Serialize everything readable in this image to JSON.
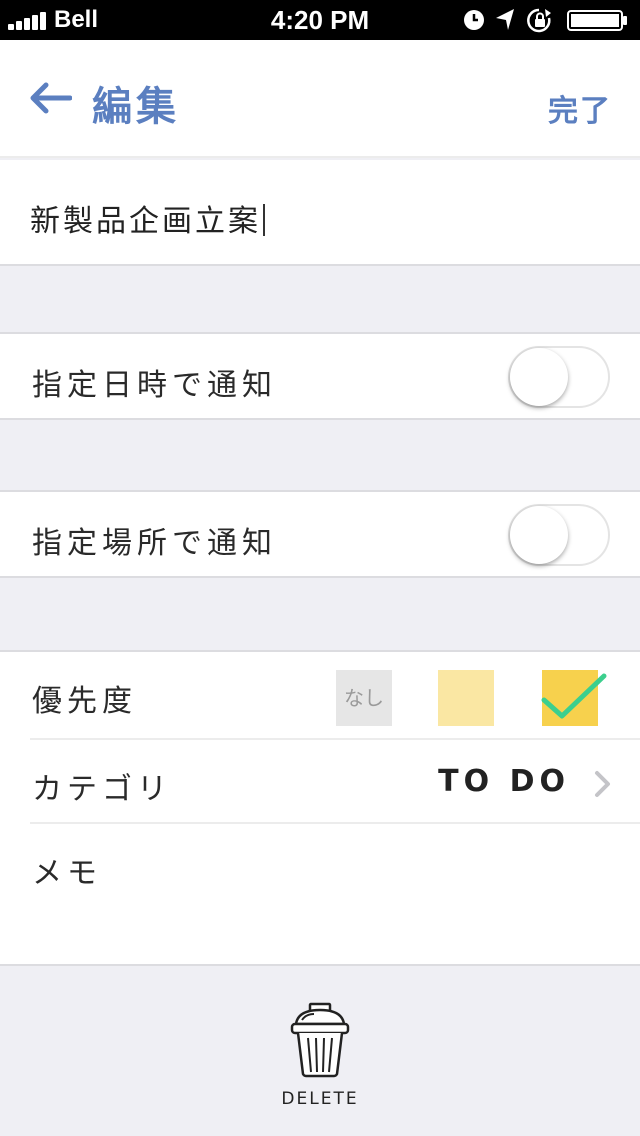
{
  "status_bar": {
    "carrier": "Bell",
    "time": "4:20 PM"
  },
  "nav": {
    "title": "編集",
    "done_label": "完了"
  },
  "task": {
    "title_value": "新製品企画立案"
  },
  "settings": {
    "notify_time_label": "指定日時で通知",
    "notify_time_on": false,
    "notify_place_label": "指定場所で通知",
    "notify_place_on": false
  },
  "priority": {
    "label": "優先度",
    "options": [
      {
        "label": "なし",
        "color": "#e6e6e6",
        "selected": false
      },
      {
        "label": "",
        "color": "#fae7a3",
        "selected": false
      },
      {
        "label": "",
        "color": "#f7d14d",
        "selected": true
      }
    ]
  },
  "category": {
    "label": "カテゴリ",
    "value": "TO DO"
  },
  "memo": {
    "label": "メモ"
  },
  "delete": {
    "label": "DELETE"
  },
  "colors": {
    "accent": "#5b7fc0",
    "check": "#3ccf8e",
    "background": "#efeff4"
  },
  "icons": [
    "back-arrow-icon",
    "alarm-icon",
    "location-arrow-icon",
    "rotation-lock-icon",
    "battery-icon",
    "checkmark-icon",
    "chevron-right-icon",
    "trash-icon"
  ]
}
